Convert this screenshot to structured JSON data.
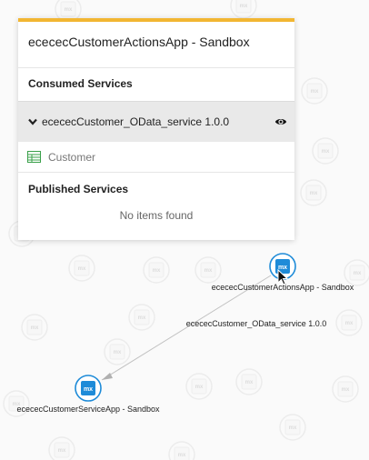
{
  "panel": {
    "title": "ececec​CustomerActionsApp - Sandbox",
    "consumed_header": "Consumed Services",
    "service": {
      "name": "ececec​Customer_OData_service 1.0.0",
      "icon": "chevron-down-icon",
      "action_icon": "eye-icon"
    },
    "entity": {
      "name": "Customer",
      "icon": "entity-table-icon"
    },
    "published_header": "Published Services",
    "published_empty": "No items found"
  },
  "graph": {
    "node_badge": "mx",
    "source_node_label": "ecececCustomerActionsApp - Sandbox",
    "target_node_label": "ecececCustomerServiceApp - Sandbox",
    "edge_label": "ecececCustomer_OData_service 1.0.0",
    "accent": "#1e8bd8",
    "panel_accent": "#f2b632"
  }
}
